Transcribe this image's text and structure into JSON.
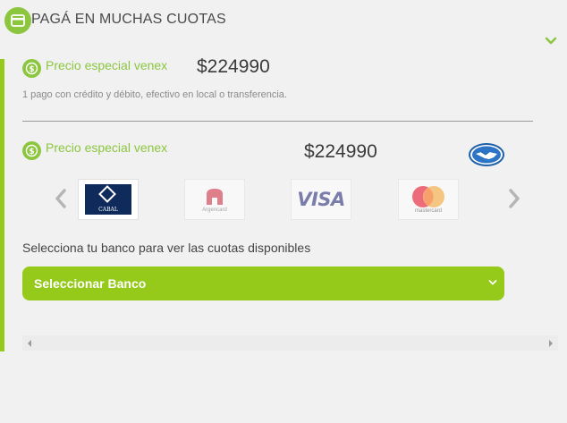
{
  "header": {
    "title": "PAGÁ EN MUCHAS CUOTAS",
    "icon": "credit-card-icon",
    "toggle_icon": "chevron-down-icon"
  },
  "offers": [
    {
      "label": "Precio especial venex",
      "price": "$224990",
      "description": "1 pago con crédito y débito, efectivo en local o transferencia."
    },
    {
      "label": "Precio especial venex",
      "price": "$224990",
      "logo": "mercadopago-logo"
    }
  ],
  "carousel": {
    "prev_icon": "chevron-left-icon",
    "next_icon": "chevron-right-icon",
    "cards": [
      {
        "name": "Cabal",
        "text": "CABAL"
      },
      {
        "name": "Argencard",
        "text": "Argencard"
      },
      {
        "name": "Visa",
        "text": "VISA"
      },
      {
        "name": "Mastercard",
        "text": "mastercard"
      }
    ]
  },
  "bank": {
    "prompt": "Selecciona tu banco para ver las cuotas disponibles",
    "select_value": "Seleccionar Banco"
  },
  "colors": {
    "accent": "#95c91a",
    "icon_green": "#8cc63f",
    "background": "#f1f1f1"
  }
}
